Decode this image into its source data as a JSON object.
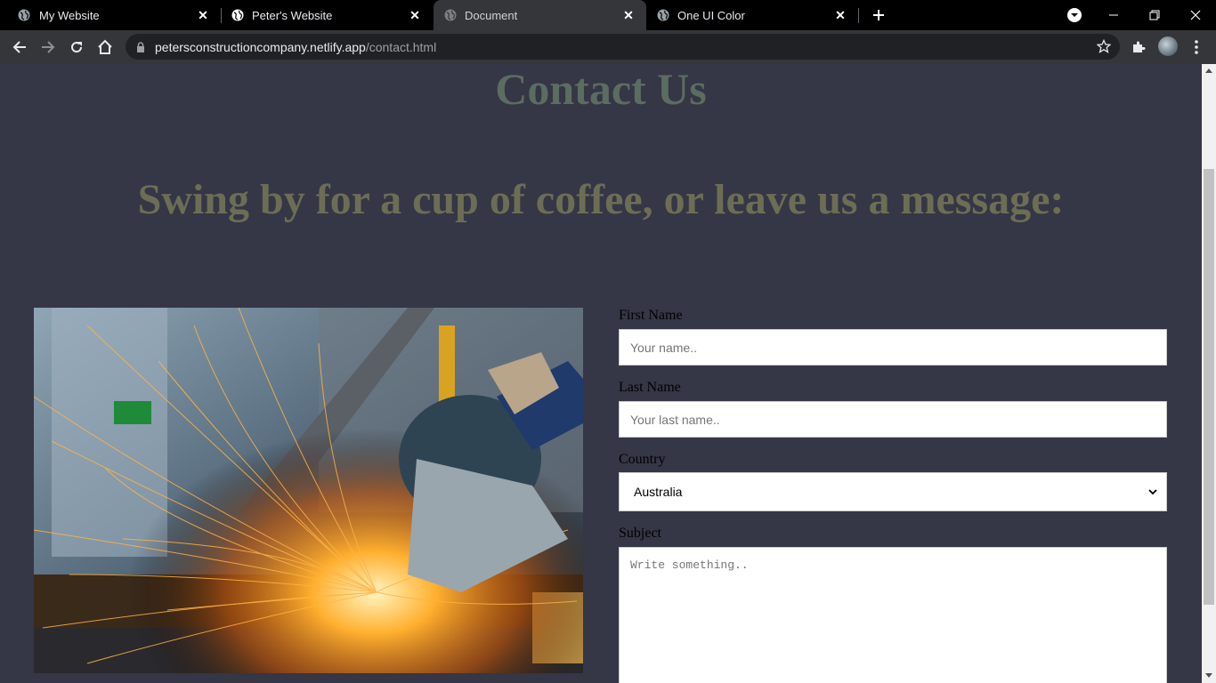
{
  "browser": {
    "tabs": [
      {
        "title": "My Website",
        "active": false
      },
      {
        "title": "Peter's Website",
        "active": false
      },
      {
        "title": "Document",
        "active": true
      },
      {
        "title": "One UI Color",
        "active": false
      }
    ],
    "url_domain": "petersconstructioncompany.netlify.app",
    "url_path": "/contact.html"
  },
  "page": {
    "heading": "Contact Us",
    "subheading": "Swing by for a cup of coffee, or leave us a message:",
    "form": {
      "first_name_label": "First Name",
      "first_name_placeholder": "Your name..",
      "last_name_label": "Last Name",
      "last_name_placeholder": "Your last name..",
      "country_label": "Country",
      "country_value": "Australia",
      "subject_label": "Subject",
      "subject_placeholder": "Write something.."
    }
  },
  "colors": {
    "page_bg": "#353646",
    "heading": "#5b6c60",
    "subheading": "#6c6d54"
  }
}
